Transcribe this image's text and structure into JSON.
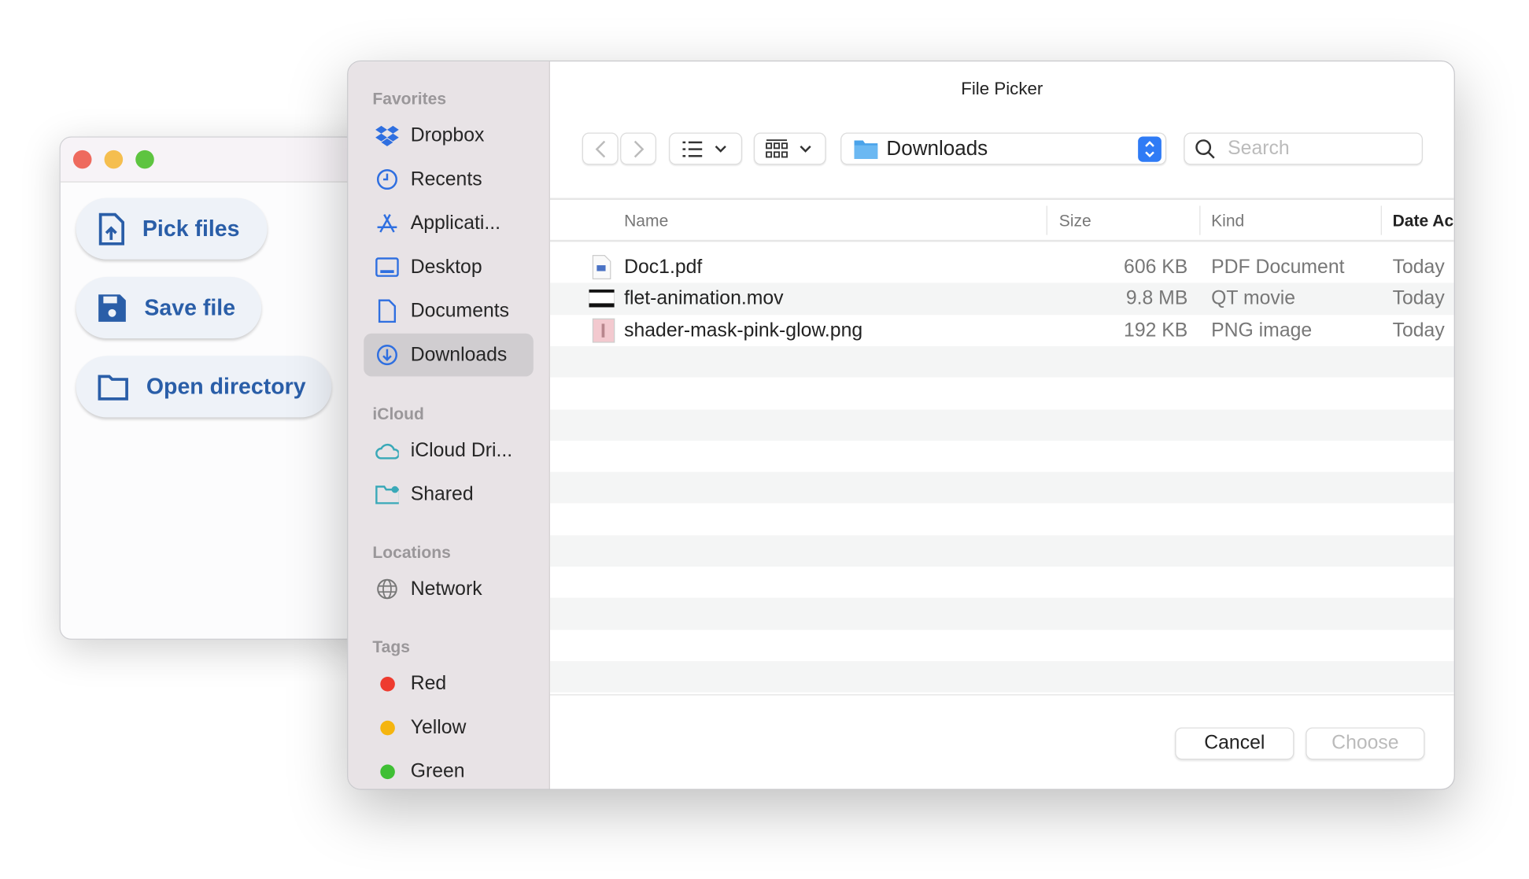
{
  "app": {
    "buttons": [
      {
        "label": "Pick files",
        "icon": "file-upload-icon"
      },
      {
        "label": "Save file",
        "icon": "floppy-disk-icon"
      },
      {
        "label": "Open directory",
        "icon": "folder-icon"
      }
    ],
    "accent": "#2a5ea8"
  },
  "dialog": {
    "title": "File Picker",
    "sidebar": {
      "sections": [
        {
          "header": "Favorites",
          "items": [
            {
              "label": "Dropbox",
              "icon": "dropbox-icon"
            },
            {
              "label": "Recents",
              "icon": "clock-icon"
            },
            {
              "label": "Applicati...",
              "icon": "app-store-icon"
            },
            {
              "label": "Desktop",
              "icon": "desktop-icon"
            },
            {
              "label": "Documents",
              "icon": "document-icon"
            },
            {
              "label": "Downloads",
              "icon": "download-icon",
              "selected": true
            }
          ]
        },
        {
          "header": "iCloud",
          "items": [
            {
              "label": "iCloud Dri...",
              "icon": "cloud-icon"
            },
            {
              "label": "Shared",
              "icon": "shared-folder-icon"
            }
          ]
        },
        {
          "header": "Locations",
          "items": [
            {
              "label": "Network",
              "icon": "globe-icon"
            }
          ]
        },
        {
          "header": "Tags",
          "items": [
            {
              "label": "Red",
              "color": "#ee3b2f"
            },
            {
              "label": "Yellow",
              "color": "#f5b50f"
            },
            {
              "label": "Green",
              "color": "#3fbf34"
            }
          ]
        }
      ]
    },
    "toolbar": {
      "location": "Downloads",
      "search_placeholder": "Search"
    },
    "columns": [
      "Name",
      "Size",
      "Kind",
      "Date Ac"
    ],
    "files": [
      {
        "name": "Doc1.pdf",
        "size": "606 KB",
        "kind": "PDF Document",
        "date": "Today"
      },
      {
        "name": "flet-animation.mov",
        "size": "9.8 MB",
        "kind": "QT movie",
        "date": "Today"
      },
      {
        "name": "shader-mask-pink-glow.png",
        "size": "192 KB",
        "kind": "PNG image",
        "date": "Today"
      }
    ],
    "cancel": "Cancel",
    "choose": "Choose"
  }
}
